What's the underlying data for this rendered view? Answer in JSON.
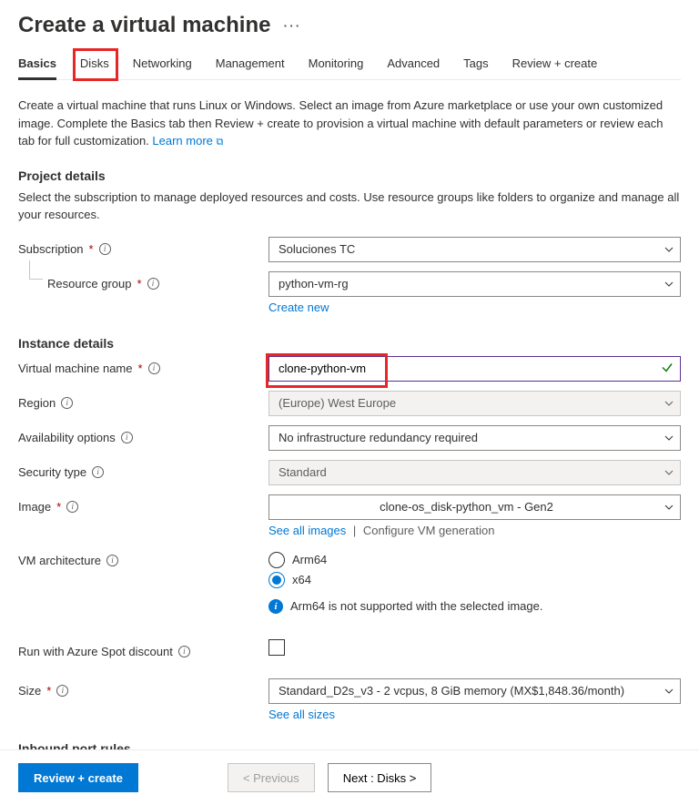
{
  "header": {
    "title": "Create a virtual machine",
    "more": "···"
  },
  "tabs": [
    {
      "label": "Basics",
      "active": true
    },
    {
      "label": "Disks",
      "highlight": true
    },
    {
      "label": "Networking"
    },
    {
      "label": "Management"
    },
    {
      "label": "Monitoring"
    },
    {
      "label": "Advanced"
    },
    {
      "label": "Tags"
    },
    {
      "label": "Review + create"
    }
  ],
  "intro": {
    "text": "Create a virtual machine that runs Linux or Windows. Select an image from Azure marketplace or use your own customized image. Complete the Basics tab then Review + create to provision a virtual machine with default parameters or review each tab for full customization. ",
    "learn_more": "Learn more"
  },
  "project": {
    "heading": "Project details",
    "desc": "Select the subscription to manage deployed resources and costs. Use resource groups like folders to organize and manage all your resources.",
    "subscription_label": "Subscription",
    "subscription_value": "Soluciones TC",
    "rg_label": "Resource group",
    "rg_value": "python-vm-rg",
    "create_new": "Create new"
  },
  "instance": {
    "heading": "Instance details",
    "vmname_label": "Virtual machine name",
    "vmname_value": "clone-python-vm",
    "region_label": "Region",
    "region_value": "(Europe) West Europe",
    "avail_label": "Availability options",
    "avail_value": "No infrastructure redundancy required",
    "security_label": "Security type",
    "security_value": "Standard",
    "image_label": "Image",
    "image_value": "clone-os_disk-python_vm - Gen2",
    "image_see_all": "See all images",
    "image_config": "Configure VM generation",
    "arch_label": "VM architecture",
    "arch_opts": {
      "arm": "Arm64",
      "x64": "x64"
    },
    "arch_info": "Arm64 is not supported with the selected image.",
    "spot_label": "Run with Azure Spot discount",
    "size_label": "Size",
    "size_value": "Standard_D2s_v3 - 2 vcpus, 8 GiB memory (MX$1,848.36/month)",
    "size_see_all": "See all sizes"
  },
  "inbound": {
    "heading": "Inbound port rules"
  },
  "footer": {
    "review": "Review + create",
    "prev": "< Previous",
    "next": "Next : Disks >"
  }
}
